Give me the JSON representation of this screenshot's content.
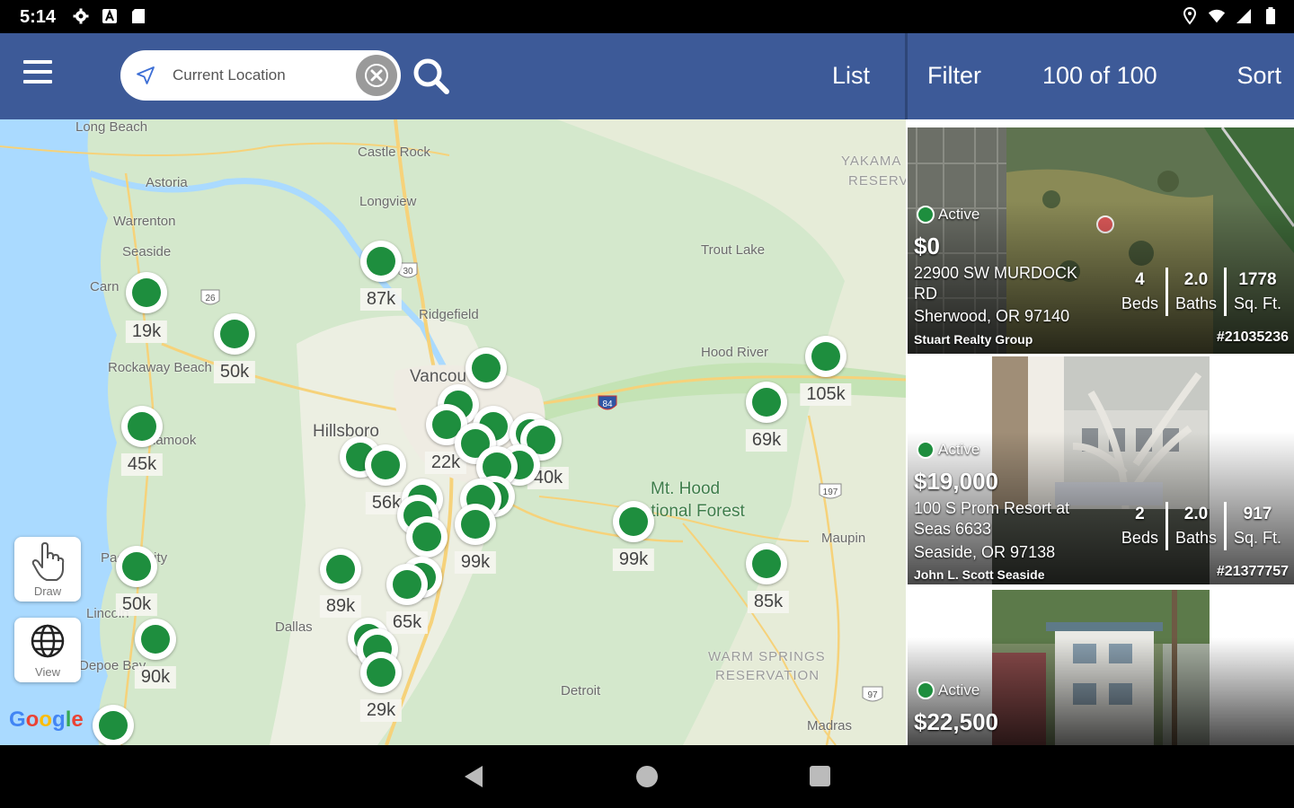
{
  "status_bar": {
    "time": "5:14",
    "left_icons": [
      "gear-icon",
      "a-badge-icon",
      "sd-card-icon"
    ],
    "right_icons": [
      "location-icon",
      "wifi-icon",
      "signal-icon",
      "battery-icon"
    ]
  },
  "header": {
    "search_placeholder": "Current Location",
    "list_label": "List",
    "filter_label": "Filter",
    "result_count": "100 of 100",
    "sort_label": "Sort"
  },
  "map": {
    "places": [
      "Long Beach",
      "Castle Rock",
      "Astoria",
      "Longview",
      "Warrenton",
      "Seaside",
      "Trout Lake",
      "Ridgefield",
      "Rockaway Beach",
      "Hood River",
      "Vancou",
      "Hillsboro",
      "Mt. Hood",
      "National Forest",
      "Maupin",
      "Dallas",
      "WARM SPRINGS",
      "RESERVATION",
      "Detroit",
      "Madras",
      "YAKAMA",
      "RESERV",
      "Depoe Bay",
      "Pacific City",
      "Carn",
      "lamook",
      "Lincoln"
    ],
    "clusters": [
      {
        "label": "87k"
      },
      {
        "label": "19k"
      },
      {
        "label": "50k"
      },
      {
        "label": "45k"
      },
      {
        "label": "50k"
      },
      {
        "label": "90k"
      },
      {
        "label": "22k"
      },
      {
        "label": "56k"
      },
      {
        "label": "89k"
      },
      {
        "label": "65k"
      },
      {
        "label": "99k"
      },
      {
        "label": "29k"
      },
      {
        "label": "105k"
      },
      {
        "label": "69k"
      },
      {
        "label": "99k"
      },
      {
        "label": "85k"
      },
      {
        "label": "40k"
      }
    ],
    "tools": [
      {
        "label": "Draw",
        "icon": "hand-pointer-icon"
      },
      {
        "label": "View",
        "icon": "globe-icon"
      }
    ],
    "attribution": "Google",
    "colors": {
      "pin": "#1e8e3e",
      "water": "#aadaff",
      "land": "#d9ead3"
    }
  },
  "listings": [
    {
      "status": "Active",
      "price": "$0",
      "address_line1": "22900 SW MURDOCK RD",
      "city": "Sherwood, OR 97140",
      "agent": "Stuart Realty Group",
      "mls": "#21035236",
      "beds": "4",
      "beds_label": "Beds",
      "baths": "2.0",
      "baths_label": "Baths",
      "sqft": "1778",
      "sqft_label": "Sq. Ft."
    },
    {
      "status": "Active",
      "price": "$19,000",
      "address_line1": "100 S Prom Resort at Seas 6633",
      "city": "Seaside, OR 97138",
      "agent": "John L. Scott Seaside",
      "mls": "#21377757",
      "beds": "2",
      "beds_label": "Beds",
      "baths": "2.0",
      "baths_label": "Baths",
      "sqft": "917",
      "sqft_label": "Sq. Ft."
    },
    {
      "status": "Active",
      "price": "$22,500"
    }
  ],
  "accent": "#3d5a98"
}
